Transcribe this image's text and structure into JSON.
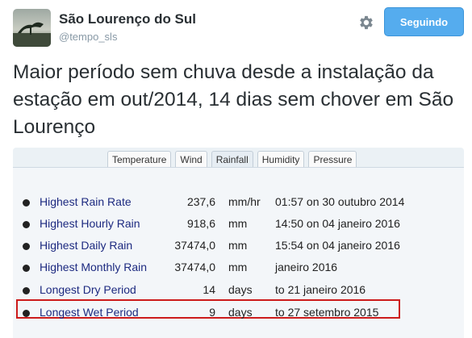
{
  "profile": {
    "display_name": "São Lourenço do Sul",
    "handle": "@tempo_sls"
  },
  "follow_button": {
    "label": "Seguindo"
  },
  "tweet": {
    "text": "Maior período sem chuva desde a instalação da estação em out/2014, 14 dias sem chover em São Lourenço"
  },
  "weather_station": {
    "tabs": [
      "Temperature",
      "Wind",
      "Rainfall",
      "Humidity",
      "Pressure"
    ],
    "active_tab": "Rainfall",
    "records": [
      {
        "label": "Highest Rain Rate",
        "value": "237,6",
        "unit": "mm/hr",
        "when": "01:57 on 30 outubro 2014"
      },
      {
        "label": "Highest Hourly Rain",
        "value": "918,6",
        "unit": "mm",
        "when": "14:50 on 04 janeiro 2016"
      },
      {
        "label": "Highest Daily Rain",
        "value": "37474,0",
        "unit": "mm",
        "when": "15:54 on 04 janeiro 2016"
      },
      {
        "label": "Highest Monthly Rain",
        "value": "37474,0",
        "unit": "mm",
        "when": "janeiro 2016"
      },
      {
        "label": "Longest Dry Period",
        "value": "14",
        "unit": "days",
        "when": "to 21 janeiro 2016",
        "highlighted": true
      },
      {
        "label": "Longest Wet Period",
        "value": "9",
        "unit": "days",
        "when": "to 27 setembro 2015"
      }
    ]
  },
  "colors": {
    "follow_button": "#55acee",
    "highlight_box": "#cc1b1b",
    "record_label": "#1d2a80"
  },
  "icons": [
    "gear-icon"
  ]
}
